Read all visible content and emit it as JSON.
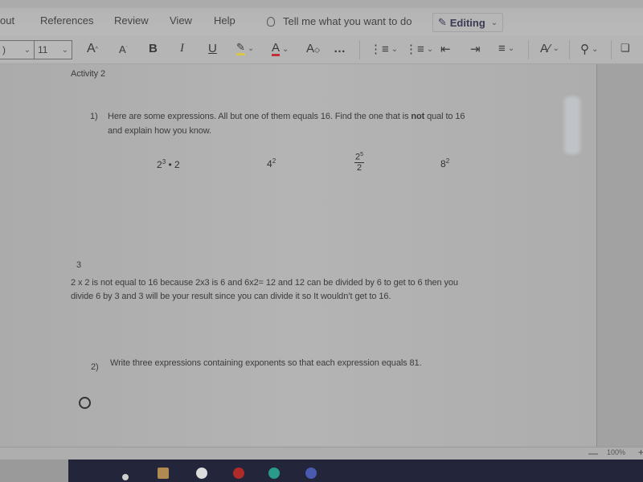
{
  "ribbon": {
    "menu": [
      {
        "label": "out"
      },
      {
        "label": "References"
      },
      {
        "label": "Review"
      },
      {
        "label": "View"
      },
      {
        "label": "Help"
      }
    ],
    "tell_me": "Tell me what you want to do",
    "editing_label": "Editing"
  },
  "toolbar": {
    "font_name": ")",
    "font_size": "11",
    "grow_font": "A",
    "shrink_font": "A",
    "bold": "B",
    "italic": "I",
    "underline": "U",
    "highlight_color": "#d8c84a",
    "font_color": "#c0303a",
    "more": "…"
  },
  "document": {
    "heading": "Activity 2",
    "q1": {
      "number": "1)",
      "line1_pre": "Here are some expressions. All but one of them equals 16. Find the one that is ",
      "line1_bold": "not",
      "line1_post": " qual to 16",
      "line2": "and explain how you know."
    },
    "expressions": [
      {
        "base": "2",
        "exp": "3",
        "tail": " • 2"
      },
      {
        "base": "4",
        "exp": "2",
        "tail": ""
      },
      {
        "num_base": "2",
        "num_exp": "5",
        "den": "2"
      },
      {
        "base": "8",
        "exp": "2",
        "tail": ""
      }
    ],
    "answer_number": "3",
    "answer_line1": "2 x 2 is not equal to 16 because 2x3 is 6 and 6x2= 12 and 12 can be divided by 6 to get to 6 then you",
    "answer_line2": "divide 6 by 3 and 3 will be your result since you can divide it so It wouldn’t get to 16.",
    "q2": {
      "number": "2)",
      "text": "Write three expressions containing exponents so that each expression equals 81."
    }
  },
  "status": {
    "zoom_minus": "—",
    "zoom_level": "100%",
    "zoom_plus": "+"
  }
}
